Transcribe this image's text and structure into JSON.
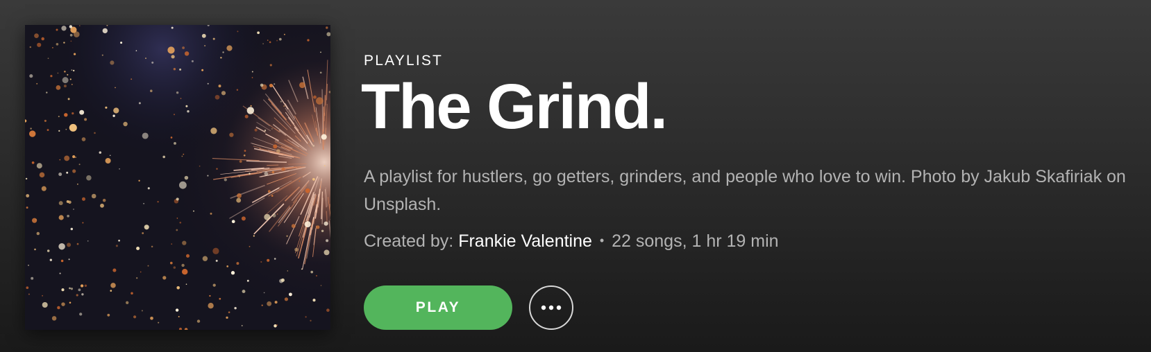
{
  "playlist": {
    "type_label": "PLAYLIST",
    "title": "The Grind.",
    "description": "A playlist for hustlers, go getters, grinders, and people who love to win. Photo by Jakub Skafiriak on Unsplash.",
    "created_by_label": "Created by:",
    "owner": "Frankie Valentine",
    "separator": "•",
    "stats": "22 songs, 1 hr 19 min"
  },
  "actions": {
    "play_label": "PLAY",
    "more_icon": "more-options-icon"
  },
  "cover": {
    "icon": "fireworks-image"
  },
  "colors": {
    "accent_green": "#53b55c",
    "text_primary": "#ffffff",
    "text_secondary": "#b3b3b3"
  }
}
